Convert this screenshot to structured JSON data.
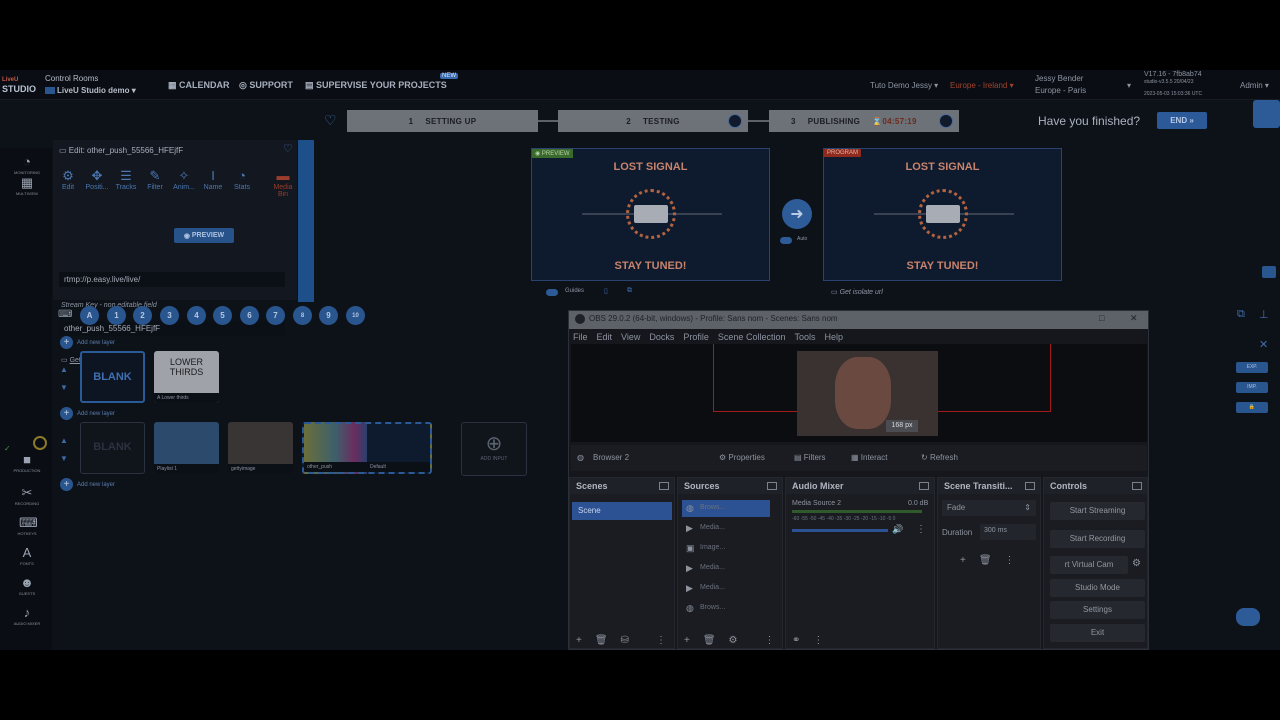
{
  "header": {
    "logo_line1": "LiveU",
    "logo_line2": "STUDIO",
    "control_rooms": "Control Rooms",
    "studio_name": "LiveU Studio demo",
    "calendar": "CALENDAR",
    "support": "SUPPORT",
    "supervise": "SUPERVISE YOUR PROJECTS",
    "new_badge": "NEW",
    "tuto": "Tuto Demo Jessy",
    "region": "Europe - Ireland",
    "user_name": "Jessy Bender",
    "user_tz": "Europe - Paris",
    "version": "V17.16 - 7fb8ab74",
    "version_detail": "studio-v3.5.5 20/04/23",
    "version_time": "2023-05-03 15:03:36 UTC",
    "role": "Admin"
  },
  "stepper": {
    "steps": [
      {
        "num": "1",
        "label": "SETTING UP"
      },
      {
        "num": "2",
        "label": "TESTING"
      },
      {
        "num": "3",
        "label": "PUBLISHING"
      }
    ],
    "timer": "04:57:19",
    "finished": "Have you finished?",
    "end": "END"
  },
  "rail": [
    {
      "icon": "monitoring-icon",
      "label": "MONITORING"
    },
    {
      "icon": "multiview-icon",
      "label": "MULTIVIEW"
    },
    {
      "icon": "production-icon",
      "label": "PRODUCTION"
    },
    {
      "icon": "recording-icon",
      "label": "RECORDING"
    },
    {
      "icon": "hotkeys-icon",
      "label": "HOTKEYS"
    },
    {
      "icon": "fonts-icon",
      "label": "FONTS"
    },
    {
      "icon": "guests-icon",
      "label": "GUESTS"
    },
    {
      "icon": "audio-mixer-icon",
      "label": "AUDIO MIXER"
    }
  ],
  "edit": {
    "title": "Edit: other_push_55566_HFEjfF",
    "tabs": [
      "Edit",
      "Positi...",
      "Tracks",
      "Filter",
      "Anim...",
      "Name",
      "Stats"
    ],
    "media_bin": "Media Bin",
    "rtmp": "rtmp://p.easy.live/live/",
    "stream_key_label": "Stream Key - non editable field",
    "stream_key": "other_push_55566_HFEjfF",
    "preview_btn": "PREVIEW",
    "isolate": "Get isolate url"
  },
  "monitors": {
    "preview_tag": "PREVIEW",
    "program_tag": "PROGRAM",
    "lost": "LOST SIGNAL",
    "stay": "STAY TUNED!",
    "auto": "Auto",
    "guides": "Guides",
    "isolate": "Get isolate url"
  },
  "layers": {
    "buttons": [
      "A",
      "1",
      "2",
      "3",
      "4",
      "5",
      "6",
      "7",
      "8",
      "9",
      "10"
    ],
    "add_new": "Add new layer",
    "blank": "BLANK",
    "lower_thirds": "LOWER THIRDS",
    "lower_thirds_label": "Lower thirds",
    "cards": [
      "Playlist 1",
      "gettyimage",
      "other_push",
      "Default"
    ],
    "add_input": "ADD INPUT"
  },
  "obs": {
    "title": "OBS 29.0.2 (64-bit, windows) - Profile: Sans nom - Scenes: Sans nom",
    "menu": [
      "File",
      "Edit",
      "View",
      "Docks",
      "Profile",
      "Scene Collection",
      "Tools",
      "Help"
    ],
    "px": "168 px",
    "source_name": "Browser 2",
    "properties": "Properties",
    "filters": "Filters",
    "interact": "Interact",
    "refresh": "Refresh",
    "docks": {
      "scenes": "Scenes",
      "sources": "Sources",
      "mixer": "Audio Mixer",
      "transitions": "Scene Transiti...",
      "controls": "Controls"
    },
    "scene": "Scene",
    "sources": [
      "Brows...",
      "Media...",
      "Image...",
      "Media...",
      "Media...",
      "Brows..."
    ],
    "mixer_source": "Media Source 2",
    "mixer_db": "0.0 dB",
    "mixer_scale": "-60 -55 -50 -45 -40 -35 -30 -25 -20 -15 -10 -5 0",
    "transition": "Fade",
    "duration_label": "Duration",
    "duration": "300 ms",
    "controls": [
      "Start Streaming",
      "Start Recording",
      "rt Virtual Cam",
      "Studio Mode",
      "Settings",
      "Exit"
    ]
  },
  "right": {
    "exp": "EXP.",
    "imp": "IMP."
  }
}
